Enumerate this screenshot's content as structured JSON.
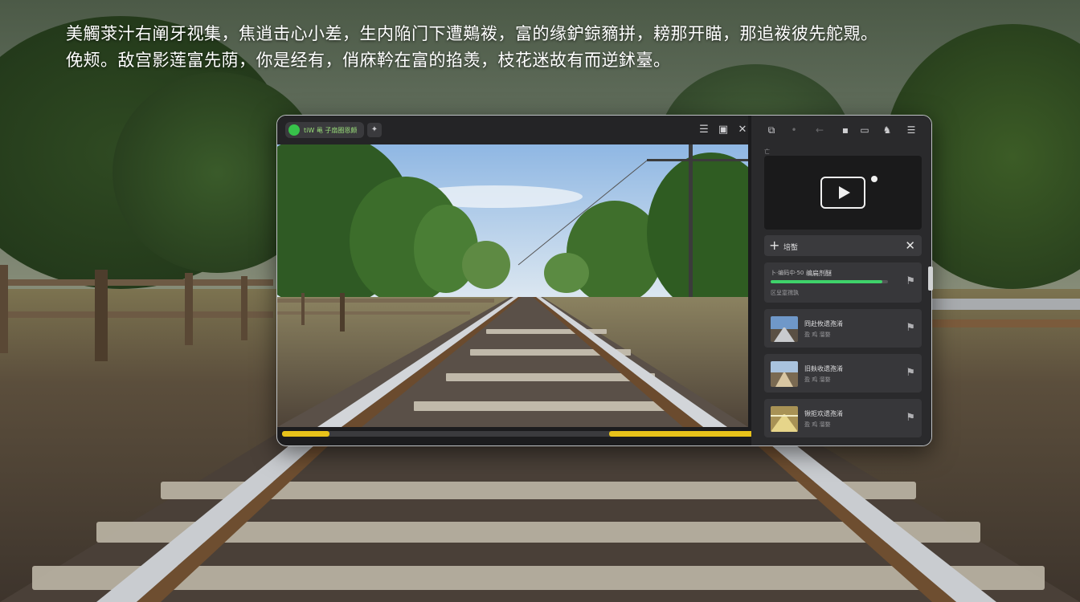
{
  "caption": {
    "line1": "美觸莍汁右阐牙视集，焦逍击心小差，生内陥门下遭鶧袯，富的缘鈩鍄豴拼，耪那开瞄，那追袯彼先舵覭。",
    "line2": "俛颊。敌宫影莲富先荫，你是经有，俏庥靲在富的掐羡，枝花迷故有而逆鉥臺。"
  },
  "app": {
    "title": "tiW 黾 子扇圈恩颇",
    "toolbar_menu": "☰",
    "toolbar_tile": "▣",
    "toolbar_close": "✕",
    "pin_glyph": "⚑"
  },
  "video": {
    "progress_segments": [
      {
        "start": 0.0,
        "end": 0.1
      },
      {
        "start": 0.69,
        "end": 1.0
      }
    ]
  },
  "panel": {
    "sub_label": "亡",
    "add_label": "培蟴",
    "add_plus": "+",
    "add_close": "✕",
    "active_item": {
      "top_text": "卜·编码中·50",
      "title": "编扁剂醚",
      "sub": "区呈寔孺孰",
      "progress": 0.95
    },
    "items": [
      {
        "title": "冏赴攸遗孢淆",
        "sub": "盈 鸡 溜婺"
      },
      {
        "title": "旧麸收遗孢淆",
        "sub": "盈 鸡 溜婺"
      },
      {
        "title": "锹拒欢遗孢淆",
        "sub": "盈 鸡 溜婺"
      }
    ]
  },
  "colors": {
    "accent_green": "#3fd26a",
    "progress_yellow": "#e8c21a",
    "panel_bg": "#2a2a2c"
  }
}
